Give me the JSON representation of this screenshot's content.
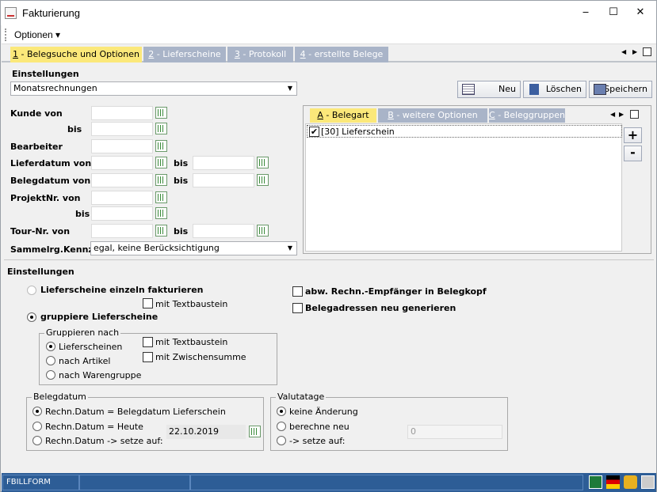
{
  "window": {
    "title": "Fakturierung",
    "minimize": "‒",
    "maximize": "☐",
    "close": "✕"
  },
  "menu": {
    "optionen": "Optionen ▾"
  },
  "tabs": [
    {
      "key": "1",
      "label": " - Belegsuche und Optionen"
    },
    {
      "key": "2",
      "label": " - Lieferscheine"
    },
    {
      "key": "3",
      "label": " - Protokoll"
    },
    {
      "key": "4",
      "label": " - erstellte Belege"
    }
  ],
  "settings": {
    "heading": "Einstellungen",
    "preset": "Monatsrechnungen",
    "btn_neu": "Neu",
    "btn_loeschen": "Löschen",
    "btn_speichern": "Speichern"
  },
  "filters": {
    "kunde_von": "Kunde von",
    "bis": "bis",
    "bearbeiter": "Bearbeiter",
    "lieferdatum_von": "Lieferdatum von",
    "belegdatum_von": "Belegdatum von",
    "projektnr_von": "ProjektNr. von",
    "tour_nr_von": "Tour-Nr. von",
    "sammelrg_label": "Sammelrg.Kennz.",
    "sammelrg_value": "egal, keine Berücksichtigung"
  },
  "subtabs": [
    {
      "key": "A",
      "label": " - Belegart"
    },
    {
      "key": "B",
      "label": " - weitere Optionen"
    },
    {
      "key": "C",
      "label": " - Beleggruppen"
    }
  ],
  "belegart_items": [
    {
      "label": "[30] Lieferschein",
      "checked": true
    }
  ],
  "options": {
    "heading": "Einstellungen",
    "einzeln": "Lieferscheine einzeln fakturieren",
    "mit_textbaustein": "mit Textbaustein",
    "gruppiere": "gruppiere Lieferscheine",
    "abw_rechn": "abw. Rechn.-Empfänger in Belegkopf",
    "belegadressen": "Belegadressen neu generieren",
    "gruppieren_nach": "Gruppieren nach",
    "nach_lieferscheinen": "Lieferscheinen",
    "nach_artikel": "nach Artikel",
    "nach_warengruppe": "nach Warengruppe",
    "grp_mit_textbaustein": "mit Textbaustein",
    "mit_zwischensumme": "mit Zwischensumme"
  },
  "belegdatum": {
    "title": "Belegdatum",
    "opt1": "Rechn.Datum = Belegdatum Lieferschein",
    "opt2": "Rechn.Datum = Heute",
    "opt3": "Rechn.Datum -> setze auf:",
    "date": "22.10.2019"
  },
  "valutatage": {
    "title": "Valutatage",
    "opt1": "keine Änderung",
    "opt2": "berechne neu",
    "opt3": "-> setze auf:",
    "value": "0"
  },
  "status": {
    "form": "FBILLFORM"
  }
}
